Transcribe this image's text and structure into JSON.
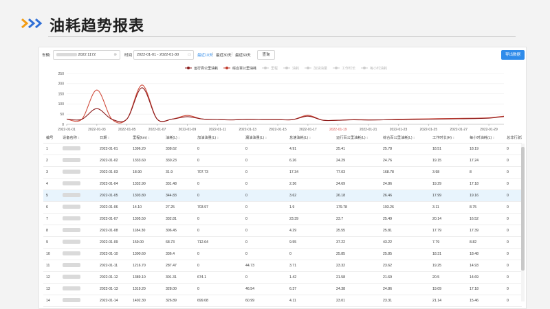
{
  "page": {
    "title": "油耗趋势报表"
  },
  "filters": {
    "vehicle_label": "车辆:",
    "vehicle_value_suffix": "2022 1172",
    "time_label": "时间",
    "date_range": "2022-01-01 - 2022-01-30",
    "quick_ranges": [
      "最近10天",
      "最近30天",
      "最近60天"
    ],
    "query_label": "查询",
    "export_label": "导出数据"
  },
  "legend": [
    {
      "label": "运行百公里油耗",
      "color": "#8b1a1a",
      "active": true
    },
    {
      "label": "综合百公里油耗",
      "color": "#c0392b",
      "active": true
    },
    {
      "label": "里程",
      "color": "#cccccc",
      "active": false
    },
    {
      "label": "油耗",
      "color": "#cccccc",
      "active": false
    },
    {
      "label": "加油油量",
      "color": "#cccccc",
      "active": false
    },
    {
      "label": "工作时长",
      "color": "#cccccc",
      "active": false
    },
    {
      "label": "每小时油耗",
      "color": "#cccccc",
      "active": false
    }
  ],
  "chart_data": {
    "type": "line",
    "x": [
      "2022-01-01",
      "2022-01-02",
      "2022-01-03",
      "2022-01-04",
      "2022-01-05",
      "2022-01-06",
      "2022-01-07",
      "2022-01-08",
      "2022-01-09",
      "2022-01-10",
      "2022-01-11",
      "2022-01-12",
      "2022-01-13",
      "2022-01-14",
      "2022-01-15",
      "2022-01-16",
      "2022-01-17",
      "2022-01-18",
      "2022-01-19",
      "2022-01-20",
      "2022-01-21",
      "2022-01-22",
      "2022-01-23",
      "2022-01-24",
      "2022-01-25",
      "2022-01-26",
      "2022-01-27",
      "2022-01-28",
      "2022-01-29",
      "2022-01-30"
    ],
    "xticks": [
      "2022-01-01",
      "2022-01-03",
      "2022-01-05",
      "2022-01-07",
      "2022-01-09",
      "2022-01-11",
      "2022-01-13",
      "2022-01-15",
      "2022-01-17",
      "2022-01-19",
      "2022-01-21",
      "2022-01-23",
      "2022-01-25",
      "2022-01-27",
      "2022-01-29"
    ],
    "highlight_tick": "2022-01-19",
    "yticks": [
      0,
      50,
      100,
      150,
      200,
      250
    ],
    "ylim": [
      0,
      250
    ],
    "grid": true,
    "series": [
      {
        "name": "运行百公里油耗",
        "color": "#8b1a1a",
        "values": [
          25.41,
          24.29,
          77.03,
          24.69,
          26.18,
          179.78,
          25.49,
          25.55,
          37.22,
          25.85,
          23.32,
          21.58,
          24.38,
          23.01,
          23,
          23,
          40,
          20,
          20,
          22,
          21,
          22,
          23,
          24,
          25,
          26,
          27,
          28,
          30,
          38
        ]
      },
      {
        "name": "综合百公里油耗",
        "color": "#d04a3a",
        "values": [
          25.78,
          24.76,
          168.78,
          24.86,
          26.46,
          193.26,
          25.48,
          25.81,
          43.22,
          25.85,
          23.62,
          21.69,
          24.86,
          23.31,
          23,
          23,
          44,
          20,
          20,
          23,
          22,
          22,
          25,
          26,
          27,
          28,
          29,
          30,
          32,
          40
        ]
      }
    ]
  },
  "table": {
    "columns": [
      "编号",
      "设备名称",
      "日期",
      "里程(km)",
      "油耗(L)",
      "加油油量(L)",
      "漏油油量(L)",
      "怠速油耗(L)",
      "运行百公里油耗(L)",
      "综合百公里油耗(L)",
      "工作时长(H)",
      "每小时油耗(L)",
      "总非行驶油耗(L)"
    ],
    "rows": [
      [
        "1",
        "2022-01-01",
        "1396.20",
        "338.62",
        "0",
        "0",
        "4.91",
        "25.41",
        "25.78",
        "18.51",
        "18.19",
        "0"
      ],
      [
        "2",
        "2022-01-02",
        "1333.60",
        "330.23",
        "0",
        "0",
        "6.26",
        "24.29",
        "24.76",
        "19.15",
        "17.24",
        "0"
      ],
      [
        "3",
        "2022-01-03",
        "18.90",
        "31.9",
        "707.73",
        "0",
        "17.34",
        "77.03",
        "168.78",
        "3.98",
        "8",
        "0"
      ],
      [
        "4",
        "2022-01-04",
        "1332.90",
        "331.48",
        "0",
        "0",
        "2.36",
        "24.69",
        "24.86",
        "19.29",
        "17.18",
        "0"
      ],
      [
        "5",
        "2022-01-05",
        "1303.80",
        "344.83",
        "0",
        "0",
        "3.62",
        "26.18",
        "26.46",
        "17.99",
        "19.16",
        "0"
      ],
      [
        "6",
        "2022-01-06",
        "14.10",
        "27.25",
        "703.97",
        "0",
        "1.9",
        "179.78",
        "193.26",
        "3.11",
        "8.75",
        "0"
      ],
      [
        "7",
        "2022-01-07",
        "1305.50",
        "332.81",
        "0",
        "0",
        "23.39",
        "23.7",
        "25.49",
        "20.14",
        "16.52",
        "0"
      ],
      [
        "8",
        "2022-01-08",
        "1184.30",
        "306.45",
        "0",
        "0",
        "4.29",
        "25.55",
        "25.81",
        "17.79",
        "17.39",
        "0"
      ],
      [
        "9",
        "2022-01-09",
        "159.00",
        "68.73",
        "712.64",
        "0",
        "9.55",
        "37.22",
        "43.22",
        "7.79",
        "8.82",
        "0"
      ],
      [
        "10",
        "2022-01-10",
        "1300.60",
        "336.4",
        "0",
        "0",
        "0",
        "25.85",
        "25.85",
        "18.31",
        "18.48",
        "0"
      ],
      [
        "11",
        "2022-01-11",
        "1216.70",
        "287.47",
        "0",
        "44.73",
        "3.71",
        "23.32",
        "23.62",
        "19.25",
        "14.93",
        "0"
      ],
      [
        "12",
        "2022-01-12",
        "1389.10",
        "301.31",
        "674.1",
        "0",
        "1.42",
        "21.58",
        "21.69",
        "20.5",
        "14.69",
        "0"
      ],
      [
        "13",
        "2022-01-13",
        "1319.20",
        "328.00",
        "0",
        "46.54",
        "6.37",
        "24.38",
        "24.86",
        "19.09",
        "17.18",
        "0"
      ],
      [
        "14",
        "2022-01-14",
        "1402.30",
        "326.89",
        "699.08",
        "60.99",
        "4.11",
        "23.01",
        "23.31",
        "21.14",
        "15.46",
        "0"
      ]
    ]
  }
}
